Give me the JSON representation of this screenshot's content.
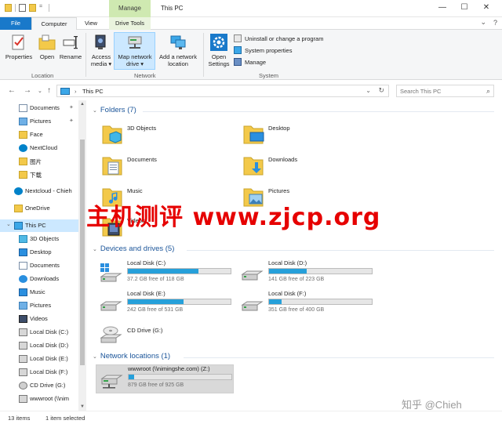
{
  "window": {
    "title": "This PC",
    "contextual_tab_group": "Manage",
    "controls": [
      "—",
      "☐",
      "✕"
    ]
  },
  "tabs": {
    "file": "File",
    "computer": "Computer",
    "view": "View",
    "drive_tools": "Drive Tools"
  },
  "ribbon": {
    "location": {
      "label": "Location",
      "properties": "Properties",
      "open": "Open",
      "rename": "Rename"
    },
    "network": {
      "label": "Network",
      "access_media_1": "Access",
      "access_media_2": "media ▾",
      "map_drive_1": "Map network",
      "map_drive_2": "drive ▾",
      "add_location_1": "Add a network",
      "add_location_2": "location"
    },
    "system": {
      "label": "System",
      "open_settings_1": "Open",
      "open_settings_2": "Settings",
      "uninstall": "Uninstall or change a program",
      "system_properties": "System properties",
      "manage": "Manage"
    }
  },
  "address": {
    "path": "This PC",
    "search_placeholder": "Search This PC"
  },
  "sidebar": {
    "items": [
      {
        "label": "Documents",
        "pinned": true
      },
      {
        "label": "Pictures",
        "pinned": true
      },
      {
        "label": "Face"
      },
      {
        "label": "NextCloud"
      },
      {
        "label": "图片"
      },
      {
        "label": "下载"
      },
      {
        "label": "Nextcloud - Chieh"
      },
      {
        "label": "OneDrive"
      },
      {
        "label": "This PC"
      },
      {
        "label": "3D Objects"
      },
      {
        "label": "Desktop"
      },
      {
        "label": "Documents"
      },
      {
        "label": "Downloads"
      },
      {
        "label": "Music"
      },
      {
        "label": "Pictures"
      },
      {
        "label": "Videos"
      },
      {
        "label": "Local Disk (C:)"
      },
      {
        "label": "Local Disk (D:)"
      },
      {
        "label": "Local Disk (E:)"
      },
      {
        "label": "Local Disk (F:)"
      },
      {
        "label": "CD Drive (G:)"
      },
      {
        "label": "wwwroot (\\\\nim"
      }
    ]
  },
  "sections": {
    "folders": "Folders (7)",
    "devices": "Devices and drives (5)",
    "network": "Network locations (1)"
  },
  "folders": [
    {
      "name": "3D Objects"
    },
    {
      "name": "Desktop"
    },
    {
      "name": "Documents"
    },
    {
      "name": "Downloads"
    },
    {
      "name": "Music"
    },
    {
      "name": "Pictures"
    },
    {
      "name": "Videos"
    }
  ],
  "drives": [
    {
      "name": "Local Disk (C:)",
      "free": "37.2 GB free of 118 GB",
      "used_fraction": 0.685
    },
    {
      "name": "Local Disk (D:)",
      "free": "141 GB free of 223 GB",
      "used_fraction": 0.368
    },
    {
      "name": "Local Disk (E:)",
      "free": "242 GB free of 531 GB",
      "used_fraction": 0.544
    },
    {
      "name": "Local Disk (F:)",
      "free": "351 GB free of 400 GB",
      "used_fraction": 0.123
    },
    {
      "name": "CD Drive (G:)"
    }
  ],
  "network_locations": [
    {
      "name": "wwwroot (\\\\nimingshe.com) (Z:)",
      "free": "879 GB free of 925 GB",
      "used_fraction": 0.05
    }
  ],
  "status": {
    "items": "13 items",
    "selected": "1 item selected"
  },
  "watermarks": {
    "red": "主机测评  www.zjcp.org",
    "gray": "知乎 @Chieh"
  },
  "colors": {
    "accent": "#1979ca",
    "manage_tab": "#cfe9b1",
    "drive_bar": "#26a0da",
    "selection": "#cce8ff",
    "watermark_red": "#e60000"
  }
}
